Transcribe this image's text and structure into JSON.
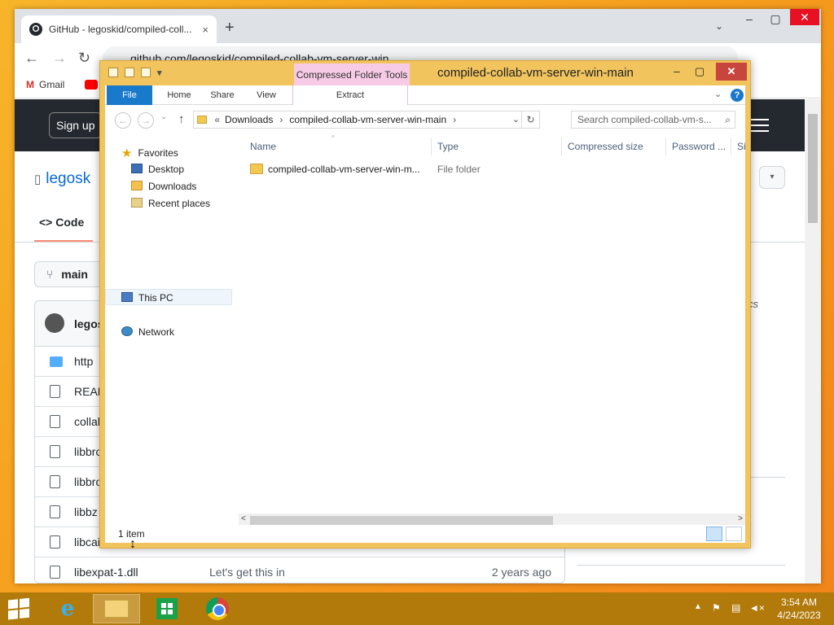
{
  "chrome": {
    "tab_title": "GitHub - legoskid/compiled-coll...",
    "tab_close": "×",
    "new_tab": "+",
    "tab_search": "⌄",
    "minimize": "–",
    "maximize": "▢",
    "close": "✕",
    "back": "←",
    "forward": "→",
    "reload": "↻",
    "url": "github.com/legoskid/compiled-collab-vm-server-win",
    "bookmarks": {
      "gmail": "Gmail"
    }
  },
  "github": {
    "sign_up": "Sign up",
    "repo_owner_partial": "legosk",
    "code_tab": "Code",
    "branch": "main",
    "owner_row": "legos",
    "side_text": "cs",
    "files": [
      {
        "name": "http",
        "type": "folder",
        "msg": "",
        "age": ""
      },
      {
        "name": "READ",
        "type": "file",
        "msg": "",
        "age": ""
      },
      {
        "name": "collal",
        "type": "file",
        "msg": "",
        "age": ""
      },
      {
        "name": "libbro",
        "type": "file",
        "msg": "",
        "age": ""
      },
      {
        "name": "libbro",
        "type": "file",
        "msg": "",
        "age": ""
      },
      {
        "name": "libbz",
        "type": "file",
        "msg": "",
        "age": ""
      },
      {
        "name": "libcai",
        "type": "file",
        "msg": "",
        "age": ""
      },
      {
        "name": "libexpat-1.dll",
        "type": "file",
        "msg": "Let's get this in",
        "age": "2 years ago"
      }
    ]
  },
  "explorer": {
    "title": "compiled-collab-vm-server-win-main",
    "contextual_group": "Compressed Folder Tools",
    "tabs": {
      "file": "File",
      "home": "Home",
      "share": "Share",
      "view": "View",
      "extract": "Extract"
    },
    "help": "?",
    "ribbon_toggle": "⌄",
    "back": "←",
    "forward": "→",
    "recent": "⌄",
    "up": "↑",
    "breadcrumb": {
      "overflow": "«",
      "seg1": "Downloads",
      "seg2": "compiled-collab-vm-server-win-main",
      "sep": "›",
      "dropdown": "⌄"
    },
    "refresh": "↻",
    "search_placeholder": "Search compiled-collab-vm-s...",
    "nav": {
      "favorites": "Favorites",
      "desktop": "Desktop",
      "downloads": "Downloads",
      "recent_places": "Recent places",
      "this_pc": "This PC",
      "network": "Network"
    },
    "columns": {
      "name": "Name",
      "type": "Type",
      "compressed_size": "Compressed size",
      "password": "Password ...",
      "size": "Si"
    },
    "sort_indicator": "^",
    "items": [
      {
        "name": "compiled-collab-vm-server-win-m...",
        "type": "File folder"
      }
    ],
    "scroll_left": "<",
    "scroll_right": ">",
    "status": "1 item"
  },
  "taskbar": {
    "ie_label": "e",
    "tray_chevron": "▲",
    "time": "3:54 AM",
    "date": "4/24/2023"
  }
}
